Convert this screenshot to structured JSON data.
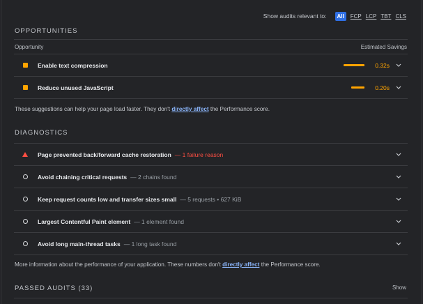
{
  "topbar": {
    "label": "Show audits relevant to:",
    "filters": [
      "All",
      "FCP",
      "LCP",
      "TBT",
      "CLS"
    ]
  },
  "opportunities": {
    "title": "OPPORTUNITIES",
    "col_left": "Opportunity",
    "col_right": "Estimated Savings",
    "items": [
      {
        "label": "Enable text compression",
        "savings": "0.32s",
        "bar_fraction": 1.0
      },
      {
        "label": "Reduce unused JavaScript",
        "savings": "0.20s",
        "bar_fraction": 0.63
      }
    ],
    "note_pre": "These suggestions can help your page load faster. They don't",
    "note_link": "directly affect",
    "note_post": "the Performance score."
  },
  "diagnostics": {
    "title": "DIAGNOSTICS",
    "items": [
      {
        "label": "Page prevented back/forward cache restoration",
        "detail": "— 1 failure reason",
        "icon": "fail-triangle-icon"
      },
      {
        "label": "Avoid chaining critical requests",
        "detail": "— 2 chains found",
        "icon": "info-circle-icon"
      },
      {
        "label": "Keep request counts low and transfer sizes small",
        "detail": "— 5 requests • 627 KiB",
        "icon": "info-circle-icon"
      },
      {
        "label": "Largest Contentful Paint element",
        "detail": "— 1 element found",
        "icon": "info-circle-icon"
      },
      {
        "label": "Avoid long main-thread tasks",
        "detail": "— 1 long task found",
        "icon": "info-circle-icon"
      }
    ],
    "note_pre": "More information about the performance of your application. These numbers don't",
    "note_link": "directly affect",
    "note_post": "the Performance score."
  },
  "passed": {
    "title": "PASSED AUDITS (33)",
    "show_label": "Show"
  },
  "colors": {
    "background": "#232427",
    "warning": "#ffa400",
    "fail": "#ff4e42",
    "link": "#8ab4f8",
    "chip": "#2f6fe4"
  }
}
